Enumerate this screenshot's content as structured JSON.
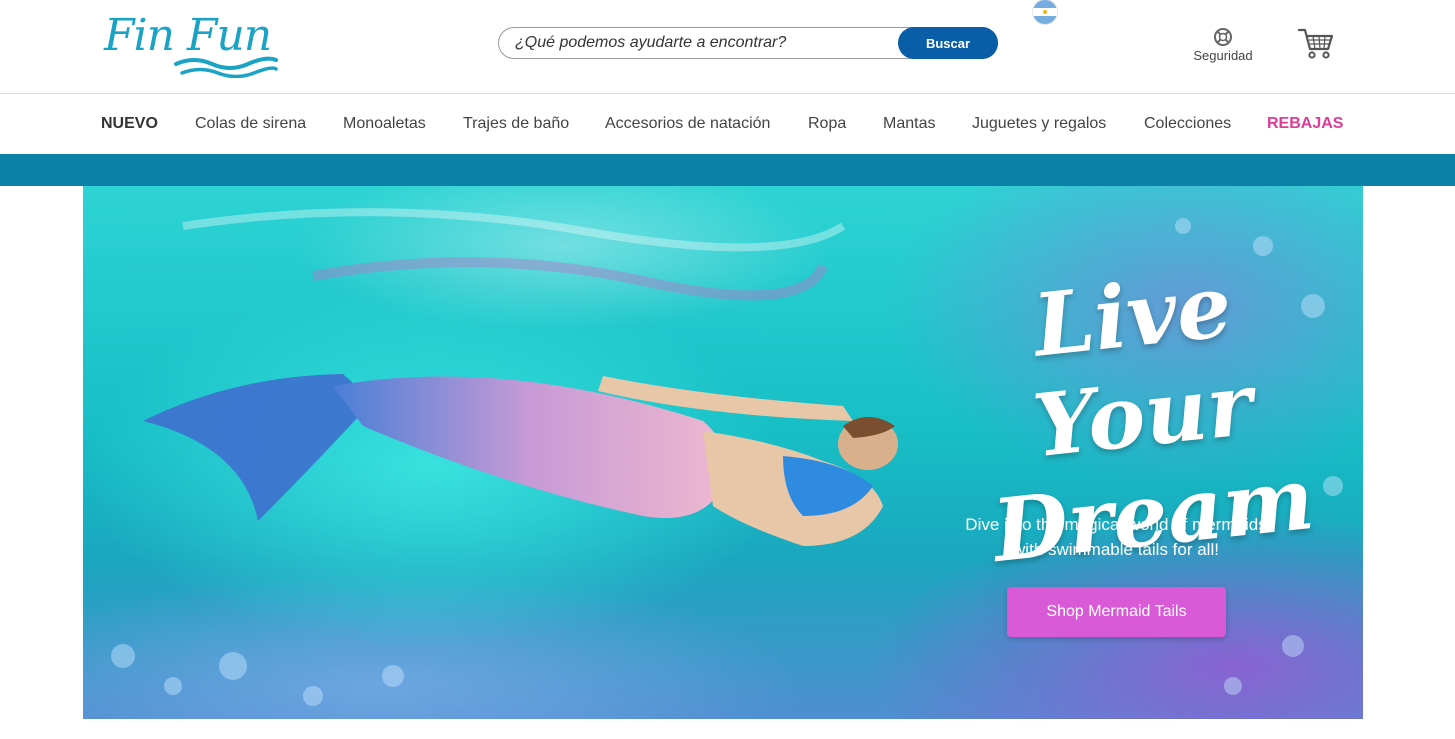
{
  "brand": {
    "logo_text": "Fin Fun"
  },
  "search": {
    "placeholder": "¿Qué podemos ayudarte a encontrar?",
    "button_label": "Buscar"
  },
  "header": {
    "security_label": "Seguridad",
    "flag_icon": "argentina-flag-icon",
    "cart_icon": "cart-icon"
  },
  "nav": {
    "items": [
      {
        "label": "NUEVO"
      },
      {
        "label": "Colas de sirena"
      },
      {
        "label": "Monoaletas"
      },
      {
        "label": "Trajes de baño"
      },
      {
        "label": "Accesorios de natación"
      },
      {
        "label": "Ropa"
      },
      {
        "label": "Mantas"
      },
      {
        "label": "Juguetes y regalos"
      },
      {
        "label": "Colecciones"
      },
      {
        "label": "REBAJAS"
      }
    ]
  },
  "hero": {
    "title_line1": "Live Your",
    "title_line2": "Dream",
    "subtitle_line1": "Dive into the magical world of mermaids",
    "subtitle_line2": "with swimmable tails for all!",
    "cta_label": "Shop Mermaid Tails"
  },
  "colors": {
    "brand_blue": "#0a5ea8",
    "band": "#0c80a7",
    "sale_pink": "#e03c97",
    "cta_pink": "#d95ad6",
    "logo_teal": "#1aa3c4"
  }
}
